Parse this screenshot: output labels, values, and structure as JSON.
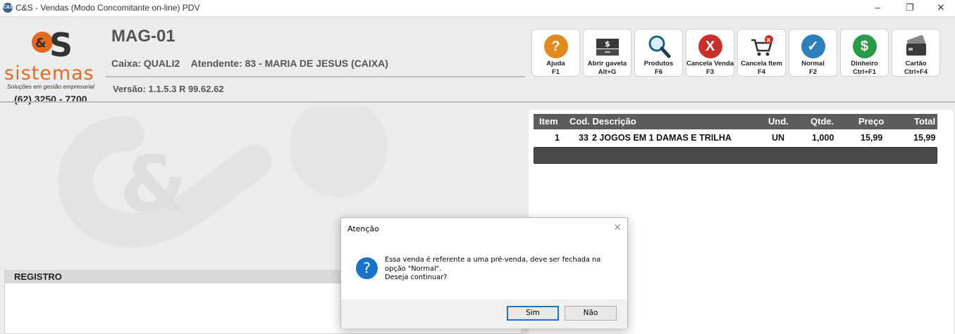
{
  "window": {
    "title": "C&S - Vendas (Modo Concomitante on-line) PDV",
    "app_icon_text": "C&S",
    "minimize": "–",
    "maximize": "❐",
    "close": "✕"
  },
  "logo": {
    "mark_text": "&S",
    "mark_small": "C",
    "brand": "sistemas",
    "tagline": "Soluções em gestão empresarial",
    "phone": "(62) 3250 - 7700",
    "colors": {
      "orange": "#e06a22",
      "dark": "#333333"
    }
  },
  "header": {
    "terminal": "MAG-01",
    "caixa": "Caixa: QUALI2",
    "atendente": "Atendente: 83 - MARIA DE JESUS (CAIXA)",
    "versao": "Versão: 1.1.5.3 R 99.62.62"
  },
  "toolbar": [
    {
      "label": "Ajuda",
      "shortcut": "F1",
      "icon": "help-icon",
      "glyph": "?",
      "color": "#e28a1e"
    },
    {
      "label": "Abrir gaveta",
      "shortcut": "Alt+G",
      "icon": "cash-drawer-icon",
      "glyph": "$",
      "color": "#3a3a3a"
    },
    {
      "label": "Produtos",
      "shortcut": "F6",
      "icon": "search-icon",
      "glyph": "",
      "color": "#1f5f8a"
    },
    {
      "label": "Cancela Venda",
      "shortcut": "F3",
      "icon": "cancel-sale-icon",
      "glyph": "X",
      "color": "#c9302c"
    },
    {
      "label": "Cancela Item",
      "shortcut": "F4",
      "icon": "cart-remove-icon",
      "glyph": "✕",
      "color": "#c9302c"
    },
    {
      "label": "Normal",
      "shortcut": "F2",
      "icon": "check-icon",
      "glyph": "✓",
      "color": "#2c7fb8"
    },
    {
      "label": "Dinheiro",
      "shortcut": "Ctrl+F1",
      "icon": "money-icon",
      "glyph": "$",
      "color": "#2a9a4a"
    },
    {
      "label": "Cartão",
      "shortcut": "Ctrl+F4",
      "icon": "card-icon",
      "glyph": "",
      "color": "#3a3a3a"
    }
  ],
  "items_table": {
    "headers": {
      "item": "Item",
      "cod_descricao": "Cod. Descrição",
      "und": "Und.",
      "qtde": "Qtde.",
      "preco": "Preço",
      "total": "Total"
    },
    "rows": [
      {
        "item": "1",
        "cod": "33",
        "descricao": "2 JOGOS EM 1 DAMAS E TRILHA",
        "und": "UN",
        "qtde": "1,000",
        "preco": "15,99",
        "total": "15,99"
      }
    ]
  },
  "registro": {
    "title": "REGISTRO"
  },
  "dialog": {
    "title": "Atenção",
    "close": "✕",
    "icon": "?",
    "message_line1": "Essa venda é referente a uma pré-venda, deve ser fechada na",
    "message_line2": "opção \"Normal\".",
    "message_line3": "Deseja continuar?",
    "yes_label": "Sim",
    "no_label": "Não"
  }
}
